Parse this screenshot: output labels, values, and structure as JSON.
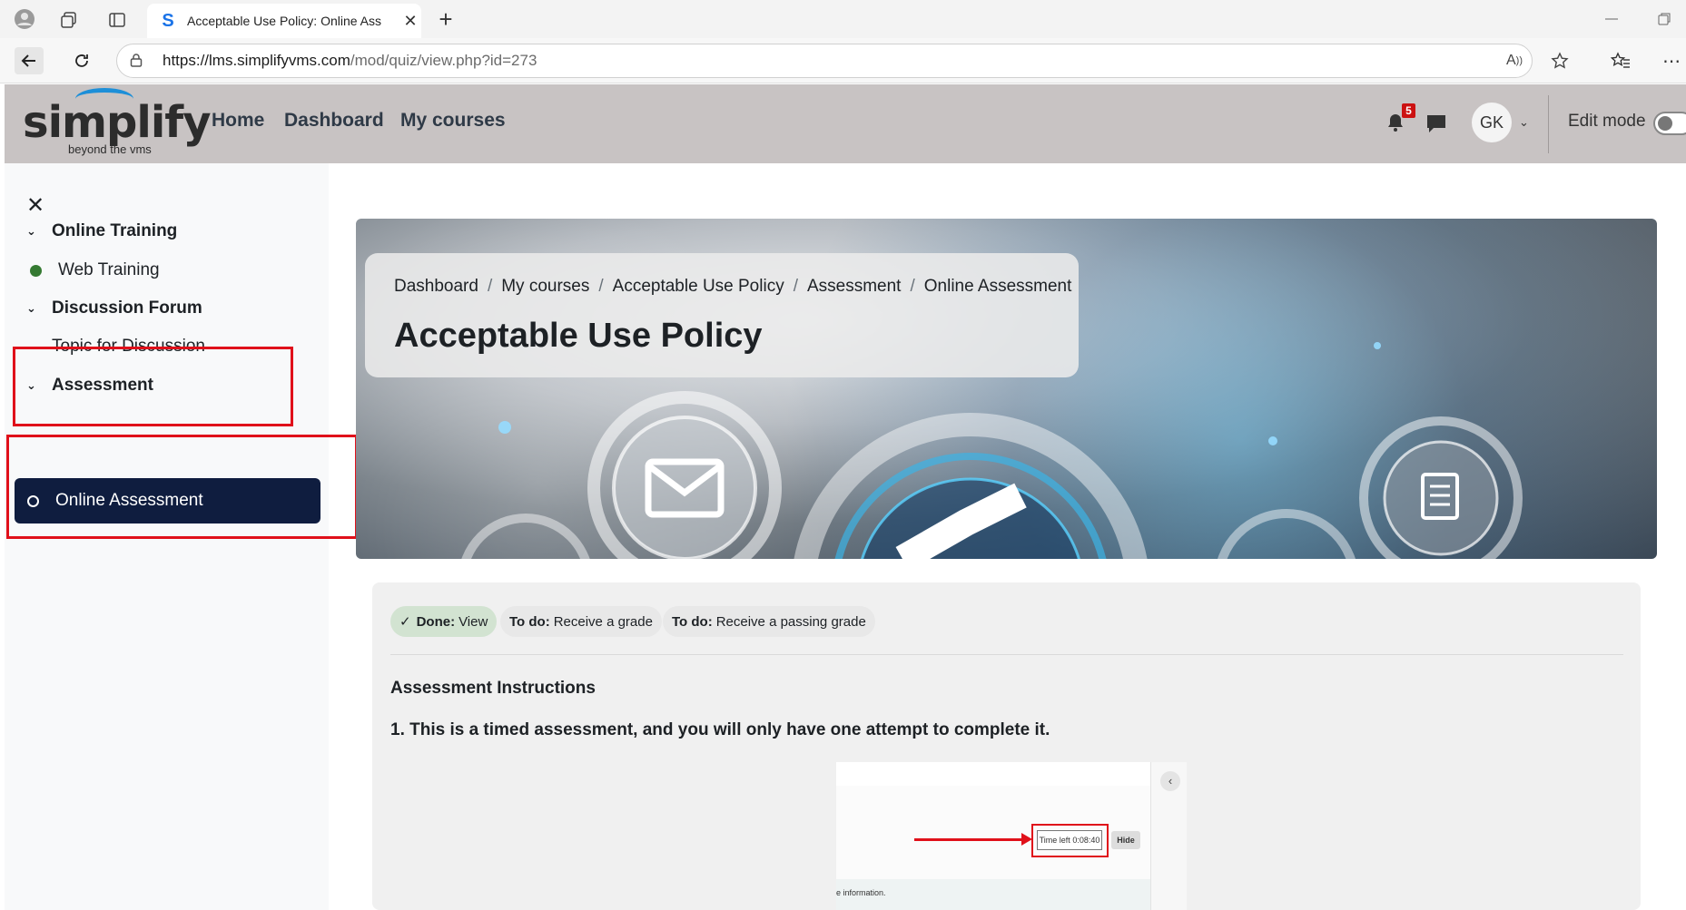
{
  "browser": {
    "tab_title": "Acceptable Use Policy: Online Ass",
    "url_host": "https://lms.simplifyvms.com",
    "url_path": "/mod/quiz/view.php?id=273",
    "icons": [
      "profile-icon",
      "workspaces-icon",
      "tab-actions-icon",
      "new-tab-icon",
      "back-icon",
      "refresh-icon",
      "lock-icon",
      "read-aloud-icon",
      "favorite-icon",
      "favorites-icon",
      "more-icon",
      "minimize-icon",
      "restore-icon"
    ]
  },
  "navbar": {
    "logo_main": "simplify",
    "logo_sub": "beyond the vms",
    "links": [
      "Home",
      "Dashboard",
      "My courses"
    ],
    "notification_count": "5",
    "avatar_initials": "GK",
    "edit_mode_label": "Edit mode",
    "edit_mode_on": false,
    "brand_color": "#1d8fd8"
  },
  "drawer": {
    "sections": [
      {
        "title": "Online Training",
        "items": [
          "Web Training"
        ]
      },
      {
        "title": "Discussion Forum",
        "items": [
          "Topic for Discussion"
        ]
      },
      {
        "title": "Assessment",
        "items": [
          "Online Assessment"
        ]
      }
    ],
    "active_item": "Online Assessment",
    "active_color": "#0f1d3f",
    "highlight_color": "#e0101a"
  },
  "header": {
    "breadcrumb": [
      "Dashboard",
      "My courses",
      "Acceptable Use Policy",
      "Assessment",
      "Online Assessment"
    ],
    "title": "Acceptable Use Policy"
  },
  "activity": {
    "completion": [
      {
        "status": "Done:",
        "text": "View"
      },
      {
        "status": "To do:",
        "text": "Receive a grade"
      },
      {
        "status": "To do:",
        "text": "Receive a passing grade"
      }
    ],
    "instructions_heading": "Assessment Instructions",
    "instruction_1": "1. This is a timed assessment, and you will only have one attempt to complete it.",
    "screenshot": {
      "timer_text": "Time left 0:08:40",
      "hide_label": "Hide",
      "info_text": "e information."
    }
  }
}
